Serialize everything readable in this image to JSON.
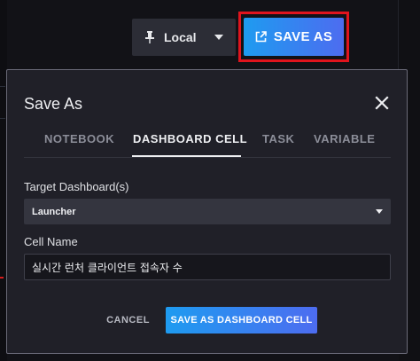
{
  "toolbar": {
    "location_label": "Local",
    "location_icon": "pin-icon",
    "save_as_label": "SAVE AS",
    "save_as_icon": "external-link-icon"
  },
  "dialog": {
    "title": "Save As",
    "tabs": [
      {
        "label": "NOTEBOOK",
        "active": false
      },
      {
        "label": "DASHBOARD CELL",
        "active": true
      },
      {
        "label": "TASK",
        "active": false
      },
      {
        "label": "VARIABLE",
        "active": false
      }
    ],
    "target_dashboard_label": "Target Dashboard(s)",
    "target_dashboard_value": "Launcher",
    "cell_name_label": "Cell Name",
    "cell_name_value": "실시간 런처 클라이언트 접속자 수",
    "cancel_label": "CANCEL",
    "submit_label": "SAVE AS DASHBOARD CELL"
  },
  "colors": {
    "accent_start": "#1e9bf0",
    "accent_end": "#4d6cf0",
    "highlight": "#e0141d",
    "dialog_bg": "#202028"
  }
}
